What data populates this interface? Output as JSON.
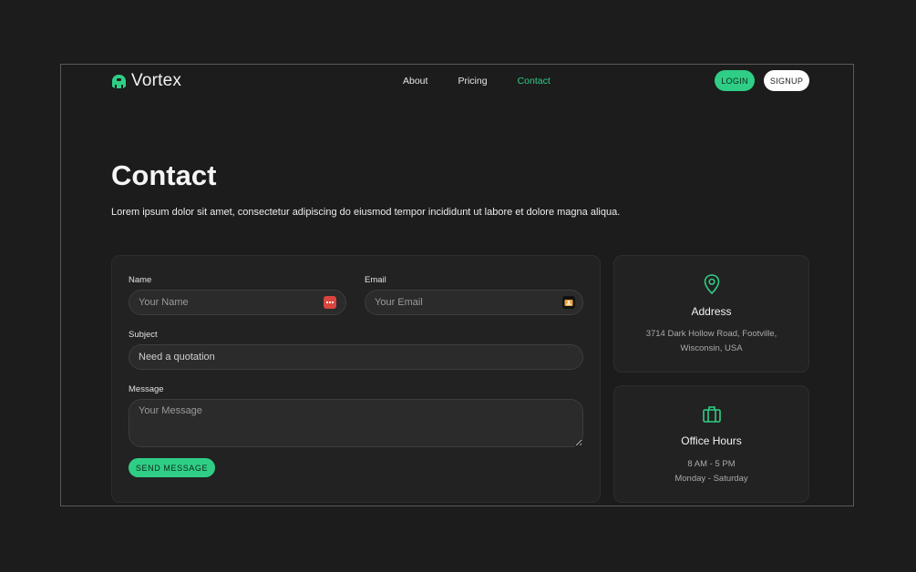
{
  "brand": {
    "name": "Vortex",
    "accent": "#2fce86"
  },
  "nav": {
    "items": [
      {
        "label": "About"
      },
      {
        "label": "Pricing"
      },
      {
        "label": "Contact"
      }
    ],
    "active": "Contact"
  },
  "auth": {
    "login_label": "LOGIN",
    "signup_label": "SIGNUP"
  },
  "hero": {
    "title": "Contact",
    "description": "Lorem ipsum dolor sit amet, consectetur adipiscing do eiusmod tempor incididunt ut labore et dolore magna aliqua."
  },
  "form": {
    "name": {
      "label": "Name",
      "placeholder": "Your Name",
      "icon": "password-manager-icon"
    },
    "email": {
      "label": "Email",
      "placeholder": "Your Email",
      "icon": "contact-card-icon"
    },
    "subject": {
      "label": "Subject",
      "value": "Need a quotation"
    },
    "message": {
      "label": "Message",
      "placeholder": "Your Message"
    },
    "submit_label": "SEND MESSAGE"
  },
  "address": {
    "icon": "map-pin-icon",
    "title": "Address",
    "line1": "3714 Dark Hollow Road, Footville,",
    "line2": "Wisconsin, USA"
  },
  "hours": {
    "icon": "briefcase-icon",
    "title": "Office Hours",
    "line1": "8 AM - 5 PM",
    "line2": "Monday - Saturday"
  }
}
